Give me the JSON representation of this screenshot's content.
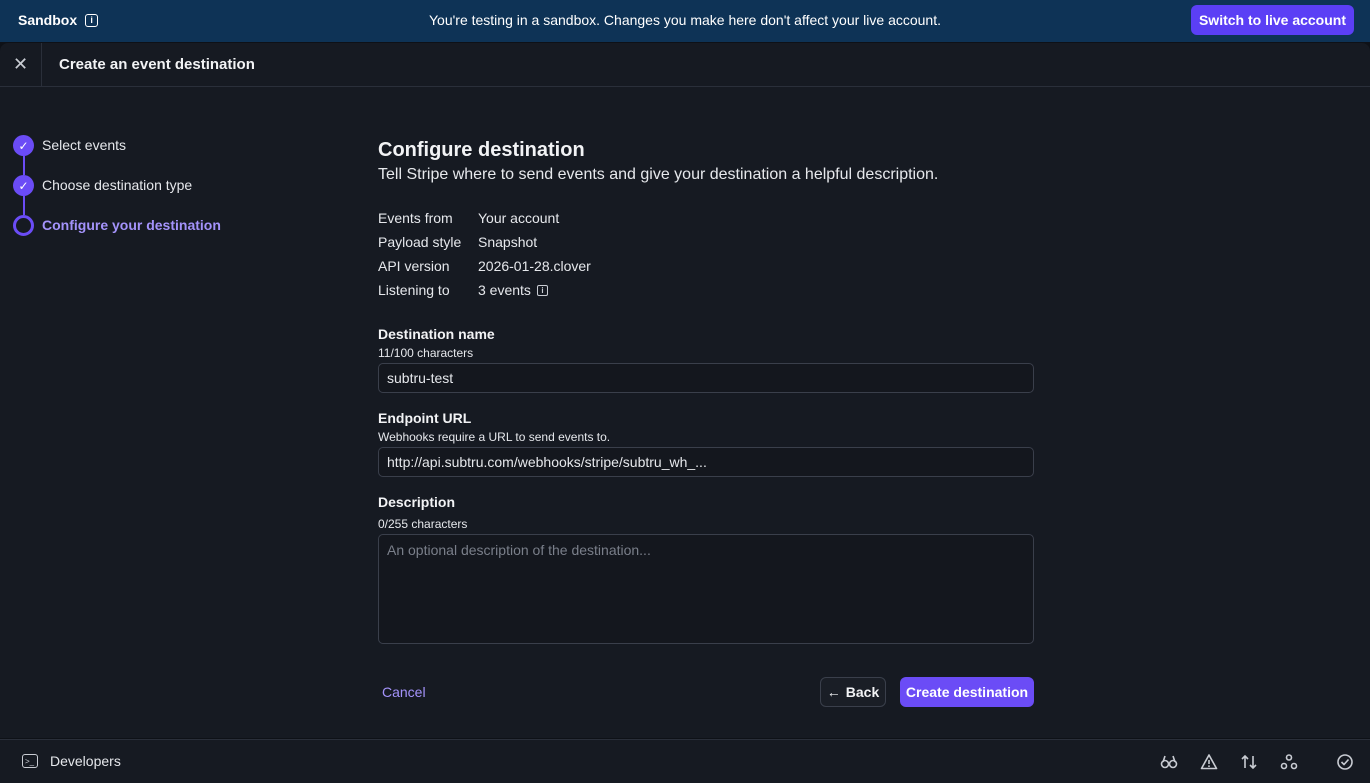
{
  "banner": {
    "label": "Sandbox",
    "message": "You're testing in a sandbox. Changes you make here don't affect your live account.",
    "switch_label": "Switch to live account"
  },
  "header": {
    "title": "Create an event destination"
  },
  "steps": [
    {
      "label": "Select events",
      "state": "done"
    },
    {
      "label": "Choose destination type",
      "state": "done"
    },
    {
      "label": "Configure your destination",
      "state": "current"
    }
  ],
  "main": {
    "title": "Configure destination",
    "subtitle": "Tell Stripe where to send events and give your destination a helpful description.",
    "meta": [
      {
        "key": "Events from",
        "value": "Your account"
      },
      {
        "key": "Payload style",
        "value": "Snapshot"
      },
      {
        "key": "API version",
        "value": "2026-01-28.clover"
      },
      {
        "key": "Listening to",
        "value": "3 events"
      }
    ],
    "name_field": {
      "label": "Destination name",
      "hint": "11/100 characters",
      "value": "subtru-test"
    },
    "url_field": {
      "label": "Endpoint URL",
      "hint": "Webhooks require a URL to send events to.",
      "value": "http://api.subtru.com/webhooks/stripe/subtru_wh_..."
    },
    "desc_field": {
      "label": "Description",
      "hint": "0/255 characters",
      "placeholder": "An optional description of the destination..."
    }
  },
  "actions": {
    "cancel": "Cancel",
    "back": "Back",
    "create": "Create destination"
  },
  "footer": {
    "label": "Developers"
  },
  "colors": {
    "accent": "#6b4cf6",
    "banner": "#0e3356",
    "background": "#161a22"
  }
}
